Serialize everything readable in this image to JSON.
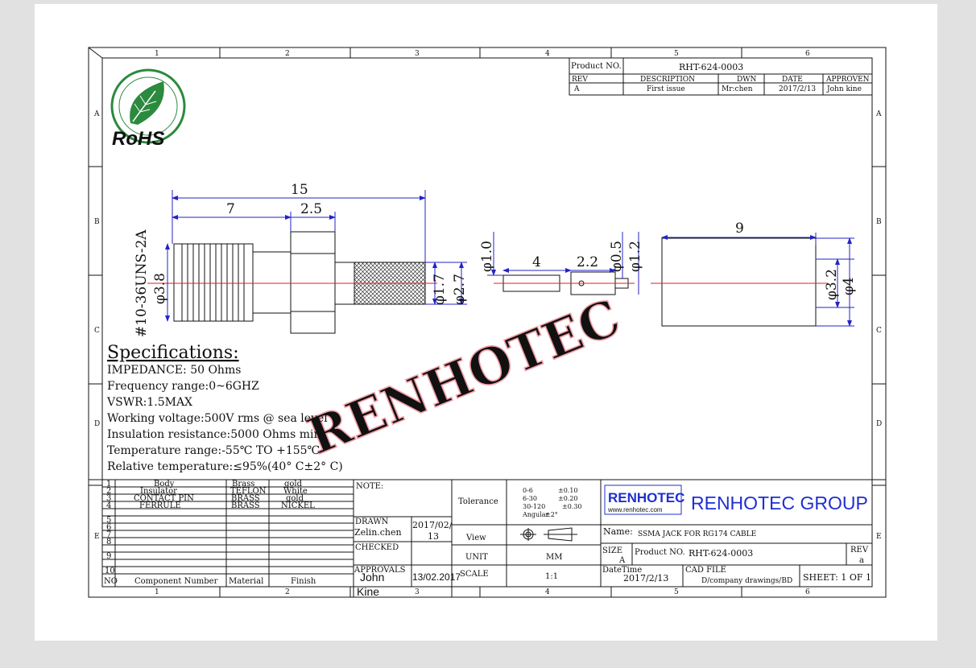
{
  "frame": {
    "top_cols": [
      "1",
      "2",
      "3",
      "4",
      "5",
      "6"
    ],
    "bottom_cols": [
      "1",
      "2",
      "3",
      "4",
      "5",
      "6"
    ],
    "rows": [
      "A",
      "B",
      "C",
      "D",
      "E"
    ]
  },
  "logo": {
    "text": "RoHS",
    "ring": "Green Product",
    "color": "#2b8a3e"
  },
  "revision": {
    "product_no_label": "Product NO.",
    "product_no": "RHT-624-0003",
    "headers": [
      "REV",
      "DESCRIPTION",
      "DWN",
      "DATE",
      "APPROVEN"
    ],
    "row": [
      "A",
      "First issue",
      "Mr:chen",
      "2017/2/13",
      "John kine"
    ]
  },
  "dimensions": {
    "overall": "15",
    "seven": "7",
    "two_five": "2.5",
    "thread": "#10-36UNS-2A",
    "d38": "φ3.8",
    "d17": "φ1.7",
    "d27": "φ2.7",
    "d10": "φ1.0",
    "four": "4",
    "two_two": "2.2",
    "d05": "φ0.5",
    "d12": "φ1.2",
    "nine": "9",
    "d32": "φ3.2",
    "d4": "φ4"
  },
  "watermark": "RENHOTEC",
  "specs": {
    "title": "Specifications:",
    "lines": [
      "IMPEDANCE: 50 Ohms",
      "Frequency range:0~6GHZ",
      "VSWR:1.5MAX",
      "Working voltage:500V rms @ sea level",
      "Insulation resistance:5000 Ohms min",
      "Temperature range:-55℃ TO +155℃",
      "Relative temperature:≤95%(40° C±2° C)"
    ]
  },
  "bom": {
    "rows": [
      [
        "1",
        "Body",
        "Brass",
        "gold"
      ],
      [
        "2",
        "Insulator",
        "TEFLON",
        "White"
      ],
      [
        "3",
        "CONTACT PIN",
        "BRASS",
        "gold"
      ],
      [
        "4",
        "FERRULE",
        "BRASS",
        "NICKEL"
      ],
      [
        "5",
        "",
        "",
        ""
      ],
      [
        "6",
        "",
        "",
        ""
      ],
      [
        "7",
        "",
        "",
        ""
      ],
      [
        "8",
        "",
        "",
        ""
      ],
      [
        "9",
        "",
        "",
        ""
      ],
      [
        "10",
        "",
        "",
        ""
      ]
    ],
    "header": [
      "NO",
      "Component Number",
      "Material",
      "Finish"
    ]
  },
  "titleblock": {
    "note": "NOTE:",
    "tolerance_label": "Tolerance",
    "tolerance": [
      "0-6",
      "±0.10",
      "6-30",
      "±0.20",
      "30-120",
      "±0.30",
      "Angular",
      "±2°"
    ],
    "drawn_label": "DRAWN",
    "drawn_name": "Zelin.chen",
    "drawn_date_a": "2017/02/",
    "drawn_date_b": "13",
    "checked_label": "CHECKED",
    "approvals_label": "APPROVALS",
    "approvals_name_a": "John",
    "approvals_name_b": "Kine",
    "approvals_date": "13/02.2017",
    "view_label": "View",
    "unit_label": "UNIT",
    "unit": "MM",
    "scale_label": "SCALE",
    "scale": "1:1",
    "company_logo": "RENHOTEC",
    "company_url": "www.renhotec.com",
    "company": "RENHOTEC GROUP",
    "name_label": "Name:",
    "name": "SSMA JACK FOR RG174 CABLE",
    "size_label": "SIZE",
    "size": "A",
    "pno_label": "Product NO.",
    "pno": "RHT-624-0003",
    "rev_label": "REV",
    "rev": "a",
    "datetime_label": "DateTime",
    "datetime": "2017/2/13",
    "cad_label": "CAD FILE",
    "cad": "D/company drawings/BD",
    "sheet": "SHEET: 1 OF 1"
  }
}
